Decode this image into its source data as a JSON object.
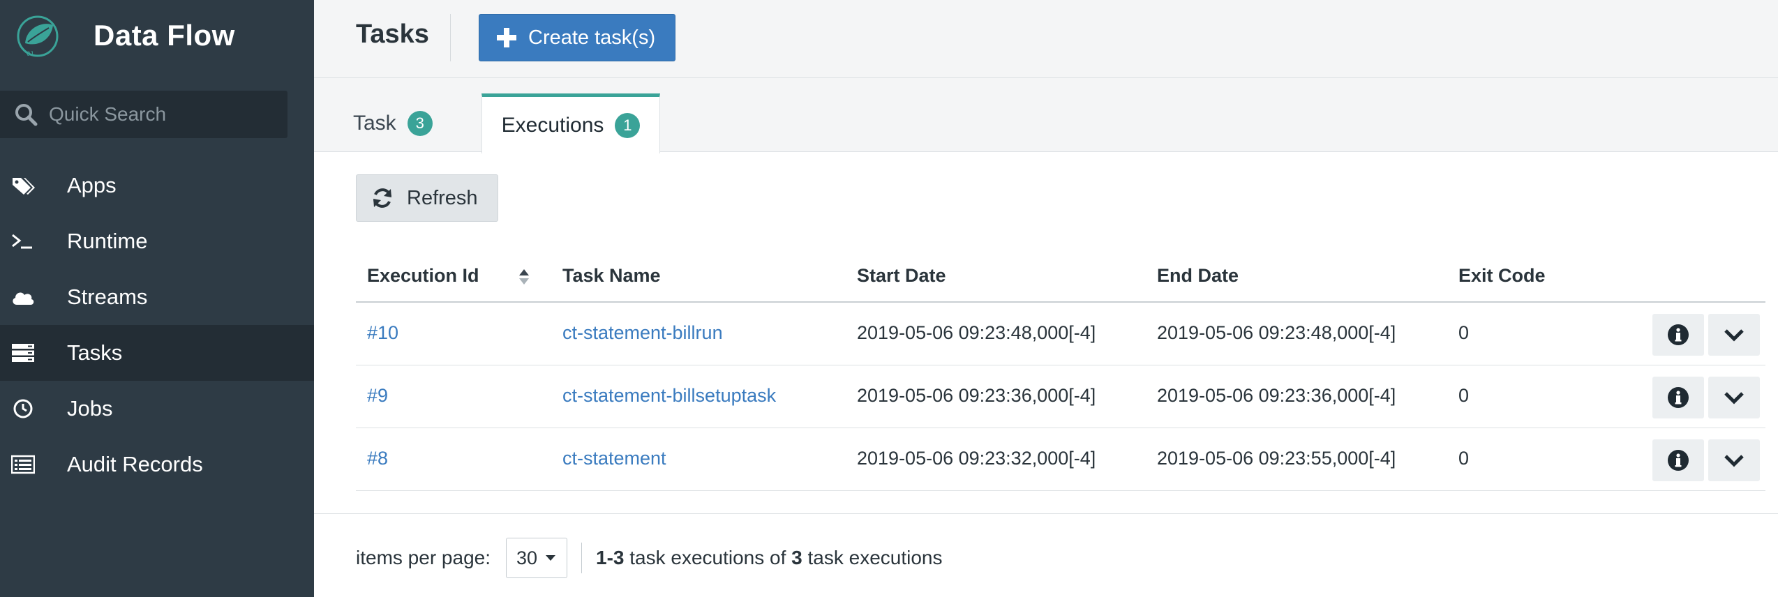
{
  "sidebar": {
    "brand": "Data Flow",
    "search_placeholder": "Quick Search",
    "items": [
      {
        "label": "Apps",
        "icon": "tags-icon"
      },
      {
        "label": "Runtime",
        "icon": "terminal-icon"
      },
      {
        "label": "Streams",
        "icon": "cloud-icon"
      },
      {
        "label": "Tasks",
        "icon": "server-icon",
        "active": true
      },
      {
        "label": "Jobs",
        "icon": "clock-icon"
      },
      {
        "label": "Audit Records",
        "icon": "list-icon"
      }
    ]
  },
  "header": {
    "title": "Tasks",
    "create_label": "Create task(s)"
  },
  "tabs": [
    {
      "label": "Task",
      "count": "3"
    },
    {
      "label": "Executions",
      "count": "1",
      "active": true
    }
  ],
  "toolbar": {
    "refresh_label": "Refresh"
  },
  "table": {
    "columns": [
      "Execution Id",
      "Task Name",
      "Start Date",
      "End Date",
      "Exit Code"
    ],
    "rows": [
      {
        "id": "#10",
        "name": "ct-statement-billrun",
        "start": "2019-05-06 09:23:48,000[-4]",
        "end": "2019-05-06 09:23:48,000[-4]",
        "exit": "0"
      },
      {
        "id": "#9",
        "name": "ct-statement-billsetuptask",
        "start": "2019-05-06 09:23:36,000[-4]",
        "end": "2019-05-06 09:23:36,000[-4]",
        "exit": "0"
      },
      {
        "id": "#8",
        "name": "ct-statement",
        "start": "2019-05-06 09:23:32,000[-4]",
        "end": "2019-05-06 09:23:55,000[-4]",
        "exit": "0"
      }
    ]
  },
  "pagination": {
    "items_per_page_label": "items per page:",
    "items_per_page": "30",
    "range": "1-3",
    "mid_text": " task executions of ",
    "total": "3",
    "end_text": " task executions"
  },
  "colors": {
    "sidebar_bg": "#2e3b45",
    "accent_teal": "#3aa398",
    "primary_blue": "#3a7bbf"
  }
}
